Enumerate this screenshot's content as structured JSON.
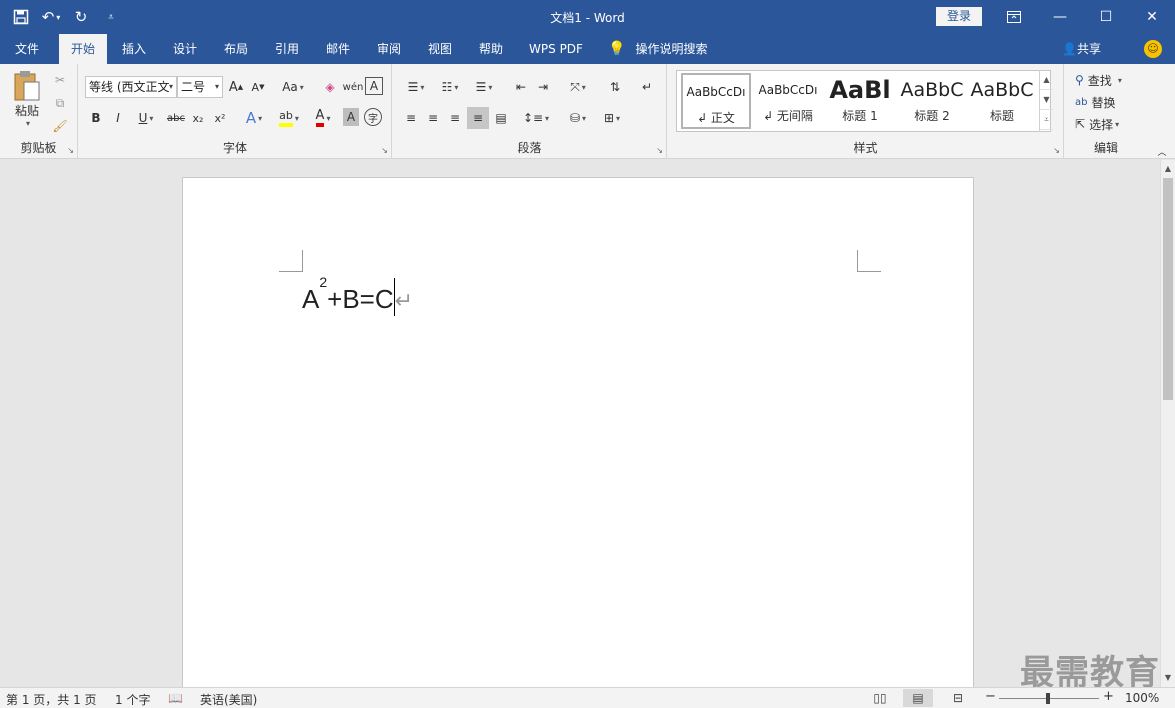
{
  "window": {
    "title": "文档1 - Word",
    "login_label": "登录"
  },
  "tabs": [
    "文件",
    "开始",
    "插入",
    "设计",
    "布局",
    "引用",
    "邮件",
    "审阅",
    "视图",
    "帮助",
    "WPS PDF"
  ],
  "active_tab": "开始",
  "tell_me": "操作说明搜索",
  "share_label": "共享",
  "ribbon": {
    "clipboard": {
      "label": "剪贴板",
      "paste_label": "粘贴"
    },
    "font": {
      "label": "字体",
      "font_name": "等线 (西文正文",
      "font_size": "二号",
      "bold": "B",
      "italic": "I",
      "underline": "U",
      "strike": "abc",
      "subscript": "x₂",
      "superscript": "x²",
      "grow": "A",
      "shrink": "A",
      "change_case": "Aa",
      "font_color_letter": "A"
    },
    "paragraph": {
      "label": "段落"
    },
    "styles": {
      "label": "样式",
      "items": [
        {
          "sample": "AaBbCcDı",
          "name": "↲ 正文"
        },
        {
          "sample": "AaBbCcDı",
          "name": "↲ 无间隔"
        },
        {
          "sample": "AaBl",
          "name": "标题 1"
        },
        {
          "sample": "AaBbC",
          "name": "标题 2"
        },
        {
          "sample": "AaBbC",
          "name": "标题"
        }
      ]
    },
    "editing": {
      "label": "编辑",
      "find": "查找",
      "replace": "替换",
      "select": "选择"
    }
  },
  "document": {
    "base": "A",
    "exponent": "2",
    "rest": "+B=C",
    "para_mark": "↵"
  },
  "watermark": "最需教育",
  "status": {
    "page": "第 1 页，共 1 页",
    "words": "1 个字",
    "language": "英语(美国)",
    "zoom_minus": "−",
    "zoom_plus": "+",
    "zoom": "100%",
    "zoom_level_percent": 100
  },
  "colors": {
    "brand": "#2b579a",
    "highlight": "#ffff00",
    "font_color": "#e00000"
  }
}
